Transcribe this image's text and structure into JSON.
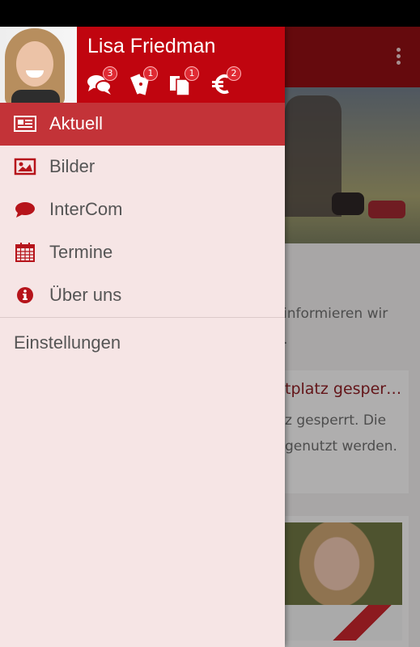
{
  "app": {
    "background_text": {
      "intro_line_1": "informieren wir",
      "intro_line_2": ".",
      "card_title": "tplatz gesper…",
      "card_line_1": "z gesperrt. Die",
      "card_line_2": "genutzt werden."
    }
  },
  "drawer": {
    "user_name": "Lisa Friedman",
    "header_icons": [
      {
        "icon": "chat-bubbles-icon",
        "count": "3"
      },
      {
        "icon": "tickets-icon",
        "count": "1"
      },
      {
        "icon": "documents-icon",
        "count": "1"
      },
      {
        "icon": "euro-icon",
        "count": "2"
      }
    ],
    "items": [
      {
        "label": "Aktuell",
        "icon": "newspaper-icon",
        "active": true
      },
      {
        "label": "Bilder",
        "icon": "image-icon",
        "active": false
      },
      {
        "label": "InterCom",
        "icon": "speech-bubble-icon",
        "active": false
      },
      {
        "label": "Termine",
        "icon": "calendar-icon",
        "active": false
      },
      {
        "label": "Über uns",
        "icon": "info-icon",
        "active": false
      }
    ],
    "settings_label": "Einstellungen"
  },
  "colors": {
    "accent": "#c0050f",
    "active_item": "#c33338",
    "drawer_bg": "#f6e5e5",
    "icon_red": "#b6141b"
  }
}
